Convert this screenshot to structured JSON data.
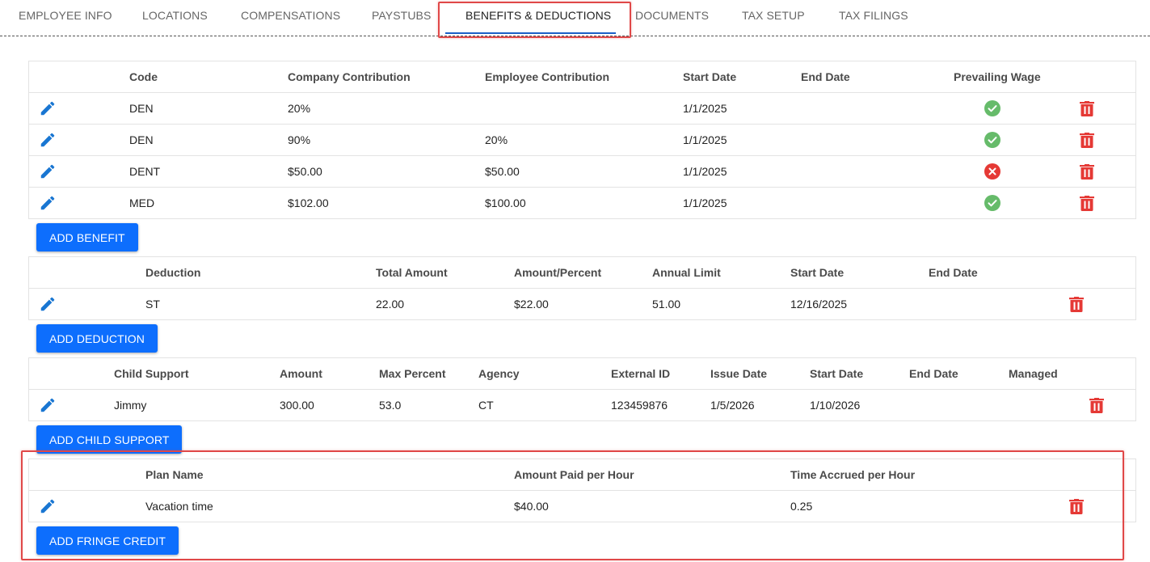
{
  "tabs": [
    {
      "label": "EMPLOYEE INFO"
    },
    {
      "label": "LOCATIONS"
    },
    {
      "label": "COMPENSATIONS"
    },
    {
      "label": "PAYSTUBS"
    },
    {
      "label": "BENEFITS & DEDUCTIONS",
      "active": true
    },
    {
      "label": "DOCUMENTS"
    },
    {
      "label": "TAX SETUP"
    },
    {
      "label": "TAX FILINGS"
    }
  ],
  "benefits": {
    "headers": [
      "Code",
      "Company Contribution",
      "Employee Contribution",
      "Start Date",
      "End Date",
      "Prevailing Wage"
    ],
    "rows": [
      {
        "code": "DEN",
        "company": "20%",
        "employee": "",
        "start": "1/1/2025",
        "end": "",
        "prevailing_wage": "check-icon"
      },
      {
        "code": "DEN",
        "company": "90%",
        "employee": "20%",
        "start": "1/1/2025",
        "end": "",
        "prevailing_wage": "check-icon"
      },
      {
        "code": "DENT",
        "company": "$50.00",
        "employee": "$50.00",
        "start": "1/1/2025",
        "end": "",
        "prevailing_wage": "cross-icon"
      },
      {
        "code": "MED",
        "company": "$102.00",
        "employee": "$100.00",
        "start": "1/1/2025",
        "end": "",
        "prevailing_wage": "check-icon"
      }
    ],
    "add_label": "ADD BENEFIT"
  },
  "deductions": {
    "headers": [
      "Deduction",
      "Total Amount",
      "Amount/Percent",
      "Annual Limit",
      "Start Date",
      "End Date"
    ],
    "rows": [
      {
        "deduction": "ST",
        "total": "22.00",
        "amount_percent": "$22.00",
        "annual_limit": "51.00",
        "start": "12/16/2025",
        "end": ""
      }
    ],
    "add_label": "ADD DEDUCTION"
  },
  "child_support": {
    "headers": [
      "Child Support",
      "Amount",
      "Max Percent",
      "Agency",
      "External ID",
      "Issue Date",
      "Start Date",
      "End Date",
      "Managed"
    ],
    "rows": [
      {
        "name": "Jimmy",
        "amount": "300.00",
        "max_percent": "53.0",
        "agency": "CT",
        "external_id": "123459876",
        "issue": "1/5/2026",
        "start": "1/10/2026",
        "end": "",
        "managed": ""
      }
    ],
    "add_label": "ADD CHILD SUPPORT"
  },
  "fringe": {
    "headers": [
      "Plan Name",
      "Amount Paid per Hour",
      "Time Accrued per Hour"
    ],
    "rows": [
      {
        "plan": "Vacation time",
        "amount_per_hour": "$40.00",
        "time_per_hour": "0.25"
      }
    ],
    "add_label": "ADD FRINGE CREDIT"
  },
  "colors": {
    "primary": "#0d6efd",
    "tab_underline": "#1a5fc7",
    "success": "#66bb6a",
    "danger": "#e53935",
    "highlight": "#e04848"
  }
}
